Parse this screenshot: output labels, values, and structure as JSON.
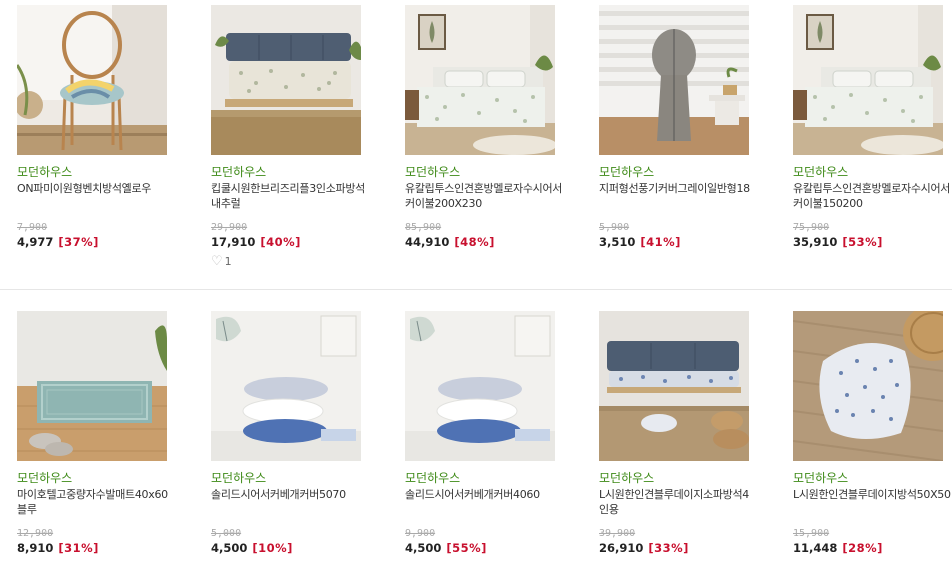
{
  "products": [
    {
      "brand": "모던하우스",
      "name": "ON파미이원형벤치방석옐로우",
      "original_price": "7,900",
      "price": "4,977",
      "discount": "[37%]",
      "thumb": "chair-cushion"
    },
    {
      "brand": "모던하우스",
      "name": "킵쿨시원한브리즈리플3인소파방석내추럴",
      "original_price": "29,900",
      "price": "17,910",
      "discount": "[40%]",
      "likes": "1",
      "thumb": "sofa-pad"
    },
    {
      "brand": "모던하우스",
      "name": "유칼립투스인견혼방멜로자수시어서커이불200X230",
      "original_price": "85,900",
      "price": "44,910",
      "discount": "[48%]",
      "thumb": "bed-quilt"
    },
    {
      "brand": "모던하우스",
      "name": "지퍼형선풍기커버그레이일반형18",
      "original_price": "5,900",
      "price": "3,510",
      "discount": "[41%]",
      "thumb": "fan-cover"
    },
    {
      "brand": "모던하우스",
      "name": "유칼립투스인견혼방멜로자수시어서커이불150200",
      "original_price": "75,900",
      "price": "35,910",
      "discount": "[53%]",
      "thumb": "bed-quilt"
    },
    {
      "brand": "모던하우스",
      "name": "마이호텔고중량자수발매트40x60블루",
      "original_price": "12,900",
      "price": "8,910",
      "discount": "[31%]",
      "thumb": "bath-mat"
    },
    {
      "brand": "모던하우스",
      "name": "솔리드시어서커베개커버5070",
      "original_price": "5,000",
      "price": "4,500",
      "discount": "[10%]",
      "thumb": "pillow-stack"
    },
    {
      "brand": "모던하우스",
      "name": "솔리드시어서커베개커버4060",
      "original_price": "9,900",
      "price": "4,500",
      "discount": "[55%]",
      "thumb": "pillow-stack"
    },
    {
      "brand": "모던하우스",
      "name": "L시원한인견블루데이지소파방석4인용",
      "original_price": "39,900",
      "price": "26,910",
      "discount": "[33%]",
      "thumb": "sofa-blue"
    },
    {
      "brand": "모던하우스",
      "name": "L시원한인견블루데이지방석50X50",
      "original_price": "15,900",
      "price": "11,448",
      "discount": "[28%]",
      "thumb": "floor-cushion"
    }
  ]
}
